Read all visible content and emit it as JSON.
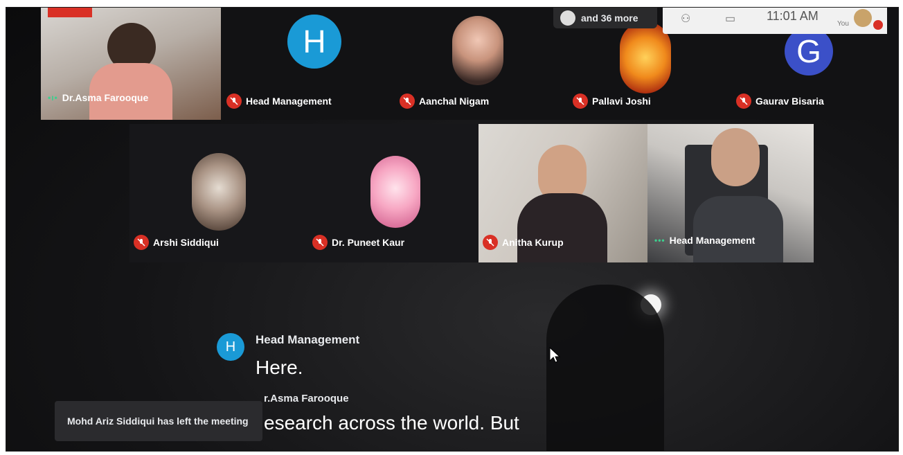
{
  "window": {
    "title": ""
  },
  "participants_top": [
    {
      "name": "Dr.Asma Farooque",
      "state": "speaking"
    },
    {
      "name": "Head Management",
      "state": "muted",
      "avatar_letter": "H",
      "avatar_color": "#1a9ad6"
    },
    {
      "name": "Aanchal Nigam",
      "state": "muted"
    },
    {
      "name": "Pallavi Joshi",
      "state": "muted"
    },
    {
      "name": "Gaurav Bisaria",
      "state": "muted",
      "avatar_letter": "G",
      "avatar_color": "#3b50c8"
    }
  ],
  "participants_mid": [
    {
      "name": "Arshi Siddiqui",
      "state": "muted"
    },
    {
      "name": "Dr. Puneet Kaur",
      "state": "muted"
    },
    {
      "name": "Anitha Kurup",
      "state": "muted"
    },
    {
      "name": "Head Management",
      "state": "speaking"
    }
  ],
  "header": {
    "more_label": "and 36 more",
    "time": "11:01 AM",
    "you_label": "You"
  },
  "captions": [
    {
      "avatar_letter": "H",
      "speaker": "Head Management",
      "text": "Here."
    },
    {
      "speaker": "r.Asma Farooque",
      "text": "esearch across the world. But"
    }
  ],
  "toast": {
    "text": "Mohd Ariz Siddiqui has left the meeting"
  },
  "colors": {
    "mute_red": "#d93025",
    "speaking_green": "#3ccf8e",
    "caption_blue": "#1a9ad6"
  }
}
